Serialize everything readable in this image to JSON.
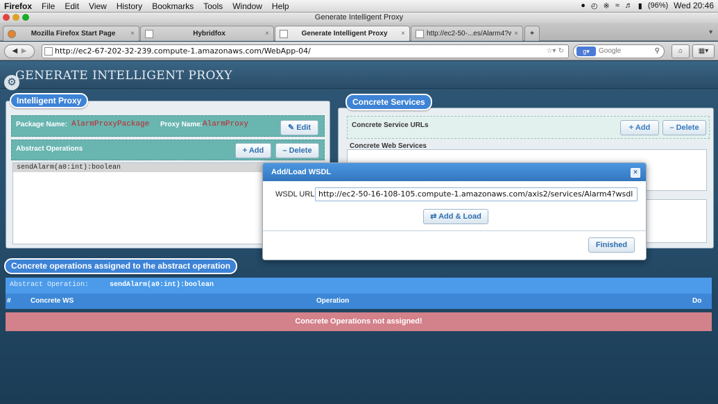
{
  "menubar": {
    "app": "Firefox",
    "items": [
      "File",
      "Edit",
      "View",
      "History",
      "Bookmarks",
      "Tools",
      "Window",
      "Help"
    ],
    "battery": "(96%)",
    "clock": "Wed 20:46"
  },
  "window": {
    "title": "Generate Intelligent Proxy"
  },
  "tabs": [
    {
      "label": "Mozilla Firefox Start Page",
      "active": false
    },
    {
      "label": "Hybridfox",
      "active": false
    },
    {
      "label": "Generate Intelligent Proxy",
      "active": true
    },
    {
      "label": "http://ec2-50-...es/Alarm4?wsdl",
      "active": false
    }
  ],
  "nav": {
    "url": "http://ec2-67-202-32-239.compute-1.amazonaws.com/WebApp-04/",
    "search_placeholder": "Google"
  },
  "page": {
    "title": "GENERATE INTELLIGENT PROXY"
  },
  "intelligent_proxy": {
    "legend": "Intelligent Proxy",
    "package_label": "Package Name:",
    "package_value": "AlarmProxyPackage",
    "proxy_label": "Proxy Name:",
    "proxy_value": "AlarmProxy",
    "edit_label": "Edit",
    "abstract_ops_label": "Abstract Operations",
    "add_label": "+ Add",
    "delete_label": "– Delete",
    "operations": [
      "sendAlarm(a0:int):boolean"
    ]
  },
  "concrete_services": {
    "legend": "Concrete Services",
    "urls_label": "Concrete Service URLs",
    "add_label": "+ Add",
    "delete_label": "– Delete",
    "web_services_label": "Concrete Web Services"
  },
  "assigned": {
    "legend": "Concrete operations assigned to the abstract operation",
    "abstract_label": "Abstract Operation:",
    "abstract_value": "sendAlarm(a0:int):boolean",
    "columns": [
      "#",
      "Concrete WS",
      "Operation",
      "Do"
    ],
    "empty_message": "Concrete Operations not assigned!"
  },
  "dialog": {
    "title": "Add/Load WSDL",
    "url_label": "WSDL URL:",
    "url_value": "http://ec2-50-16-108-105.compute-1.amazonaws.com/axis2/services/Alarm4?wsdl",
    "add_load_label": "Add & Load",
    "finished_label": "Finished"
  },
  "colors": {
    "accent": "#3d83d6",
    "teal": "#69b5b0",
    "alert": "#d3818a",
    "brand_dark": "#27506e"
  }
}
